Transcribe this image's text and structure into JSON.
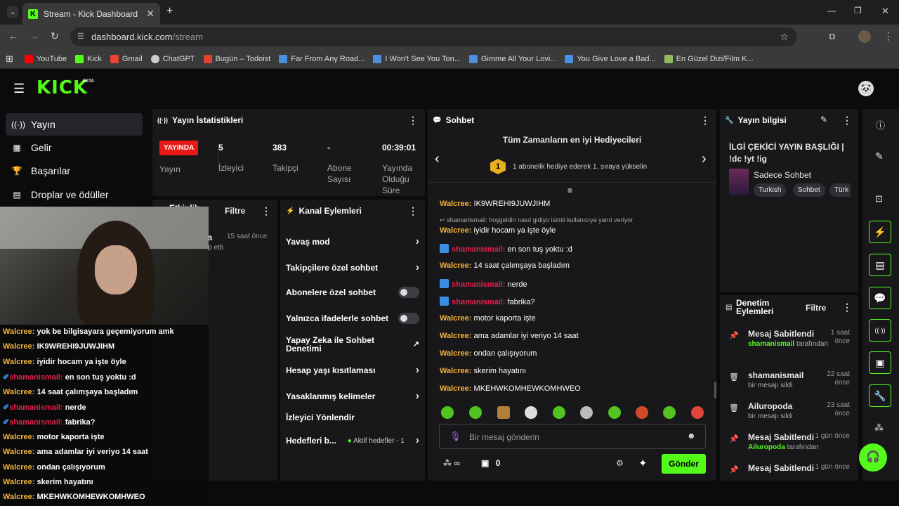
{
  "browser": {
    "tab_title": "Stream - Kick Dashboard",
    "url_host": "dashboard.kick.com",
    "url_path": "/stream",
    "bookmarks": [
      "YouTube",
      "Kick",
      "Gmail",
      "ChatGPT",
      "Bugün – Todoist",
      "Far From Any Road...",
      "I Won't See You Ton...",
      "Gimme All Your Lovi...",
      "You Give Love a Bad...",
      "En Güzel Dizi/Film K..."
    ]
  },
  "header": {
    "logo": "KICK",
    "logo_tag": "BETA"
  },
  "nav": {
    "items": [
      "Yayın",
      "Gelir",
      "Başarılar",
      "Droplar ve ödüller"
    ]
  },
  "stats": {
    "title": "Yayın İstatistikleri",
    "live_badge": "YAYINDA",
    "live_label": "Yayın",
    "viewers_value": "5",
    "viewers_label": "İzleyici",
    "followers_value": "383",
    "followers_label": "Takipçi",
    "subs_value": "-",
    "subs_label": "Abone Sayısı",
    "duration_value": "00:39:01",
    "duration_label": "Yayında Olduğu Süre"
  },
  "activity": {
    "title": "Etkinlik",
    "filter": "Filtre",
    "item_name": "ea",
    "item_time": "15 saat önce",
    "item_text": "kip etti"
  },
  "actions": {
    "title": "Kanal Eylemleri",
    "slow": "Yavaş mod",
    "followers_only": "Takipçilere özel sohbet",
    "subs_only": "Abonelere özel sohbet",
    "emotes_only": "Yalnızca ifadelerle sohbet",
    "ai": "Yapay Zeka ile Sohbet Denetimi",
    "age": "Hesap yaşı kısıtlaması",
    "banned": "Yasaklanmış kelimeler",
    "redirect": "İzleyici Yönlendir",
    "goals": "Hedefleri b...",
    "goals_status": "Aktif hedefler - 1"
  },
  "chat": {
    "title": "Sohbet",
    "gifters_title": "Tüm Zamanların en iyi Hediyecileri",
    "gifters_rank": "1",
    "gifters_text": "1 abonelik hediye ederek 1. sıraya yükselin",
    "reply_note": "shamanismail: hoşgeldin nasıl gidiyo isimli kullanıcıya yanıt veriyor",
    "messages": [
      {
        "user": "Walcree",
        "text": "IK9WREHI9JUWJIHM"
      },
      {
        "user": "Walcree",
        "text": "iyidir hocam ya işte öyle"
      },
      {
        "user": "shamanismail",
        "text": "en son tuş yoktu :d"
      },
      {
        "user": "Walcree",
        "text": "14 saat çalımşaya başladım"
      },
      {
        "user": "shamanismail",
        "text": "nerde"
      },
      {
        "user": "shamanismail",
        "text": "fabrika?"
      },
      {
        "user": "Walcree",
        "text": "motor kaporta işte"
      },
      {
        "user": "Walcree",
        "text": "ama adamlar iyi veriyo 14 saat"
      },
      {
        "user": "Walcree",
        "text": "ondan çalışıyorum"
      },
      {
        "user": "Walcree",
        "text": "skerim hayatını"
      },
      {
        "user": "Walcree",
        "text": "MKEHWKOMHEWKOMHWEO"
      }
    ],
    "input_placeholder": "Bir mesaj gönderin",
    "points": "∞",
    "chest_count": "0",
    "send": "Gönder"
  },
  "info": {
    "title": "Yayın bilgisi",
    "stream_title": "İLGİ ÇEKİCİ YAYIN BAŞLIĞI | !dc !yt !ig",
    "category": "Sadece Sohbet",
    "tags": [
      "Turkish",
      "Sohbet",
      "Türk"
    ]
  },
  "mod": {
    "title": "Denetim Eylemleri",
    "filter": "Filtre",
    "entries": [
      {
        "action": "Mesaj Sabitlendi",
        "by": "shamanismail",
        "suffix": "tarafından",
        "time": "1 saat önce"
      },
      {
        "action": "shamanismail",
        "by": "",
        "suffix": "bir mesajı sildi",
        "time": "22 saat önce"
      },
      {
        "action": "Ailuropoda",
        "by": "",
        "suffix": "bir mesajı sildi",
        "time": "23 saat önce"
      },
      {
        "action": "Mesaj Sabitlendi",
        "by": "Ailuropoda",
        "suffix": "tarafından",
        "time": "1 gün önce"
      },
      {
        "action": "Mesaj Sabitlendi",
        "by": "",
        "suffix": "",
        "time": "1 gün önce"
      }
    ]
  },
  "overlay": {
    "messages": [
      {
        "user": "Walcree",
        "text": "yok be bilgisayara geçemiyorum amk"
      },
      {
        "user": "Walcree",
        "text": "IK9WREHI9JUWJIHM"
      },
      {
        "user": "Walcree",
        "text": "iyidir hocam ya işte öyle"
      },
      {
        "user": "shamanismail",
        "text": "en son tuş yoktu :d"
      },
      {
        "user": "Walcree",
        "text": "14 saat çalımşaya başladım"
      },
      {
        "user": "shamanismail",
        "text": "nerde"
      },
      {
        "user": "shamanismail",
        "text": "fabrika?"
      },
      {
        "user": "Walcree",
        "text": "motor kaporta işte"
      },
      {
        "user": "Walcree",
        "text": "ama adamlar iyi veriyo 14 saat"
      },
      {
        "user": "Walcree",
        "text": "ondan çalışıyorum"
      },
      {
        "user": "Walcree",
        "text": "skerim hayatını"
      },
      {
        "user": "Walcree",
        "text": "MKEHWKOMHEWKOMHWEO"
      }
    ]
  },
  "colors": {
    "accent": "#53fc18",
    "live": "#e91916",
    "user_walcree": "#f6b33c",
    "user_shaman": "#e5204f"
  }
}
